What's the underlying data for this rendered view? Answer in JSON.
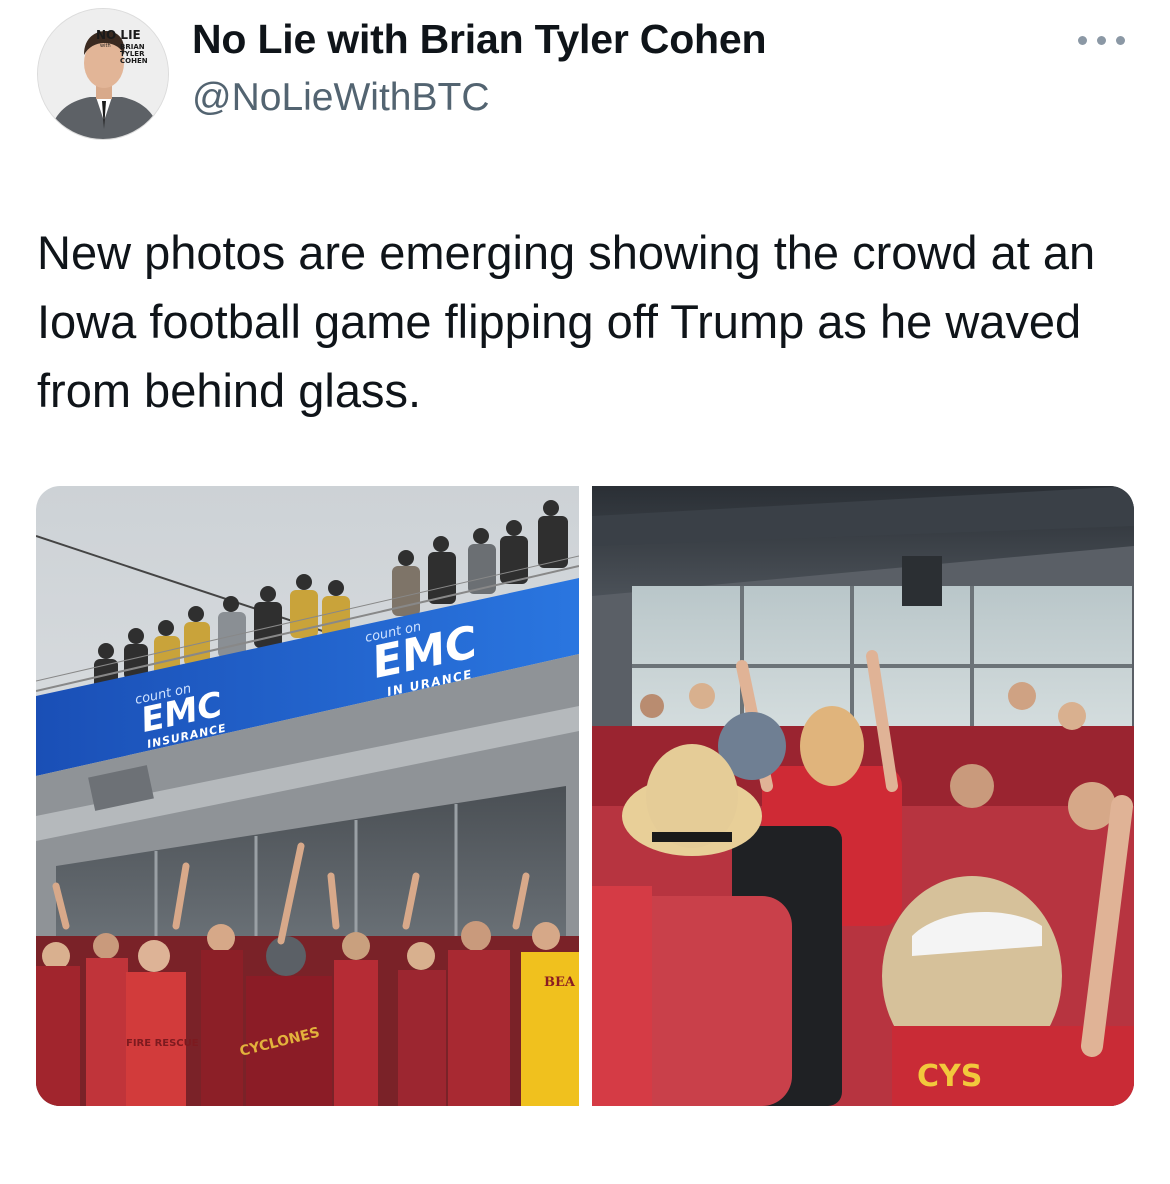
{
  "author": {
    "display_name": "No Lie with Brian Tyler Cohen",
    "handle": "@NoLieWithBTC",
    "avatar_text": {
      "line1": "NO LIE",
      "line2": "with",
      "line3": "BRIAN",
      "line4": "TYLER",
      "line5": "COHEN"
    }
  },
  "more_menu_icon": "more-dots-icon",
  "tweet": {
    "text": "New photos are emerging showing the crowd at an Iowa football game flipping off Trump as he waved from behind glass."
  },
  "media": {
    "left_photo": {
      "banner_tagline": "count on",
      "banner_brand": "EMC",
      "banner_sub": "INSURANCE",
      "banner_sub_partial": "IN  URANCE",
      "shirt_text_1": "CYCLONES",
      "shirt_text_2": "FIRE RESCUE",
      "shirt_text_3": "BEA IOW"
    },
    "right_photo": {
      "shirt_text": "CYS"
    }
  },
  "colors": {
    "primary_text": "#0f1419",
    "secondary_text": "#536471",
    "iowa_state_cardinal": "#b01e24",
    "iowa_state_gold": "#f0b323",
    "emc_blue": "#1f5fc9"
  }
}
